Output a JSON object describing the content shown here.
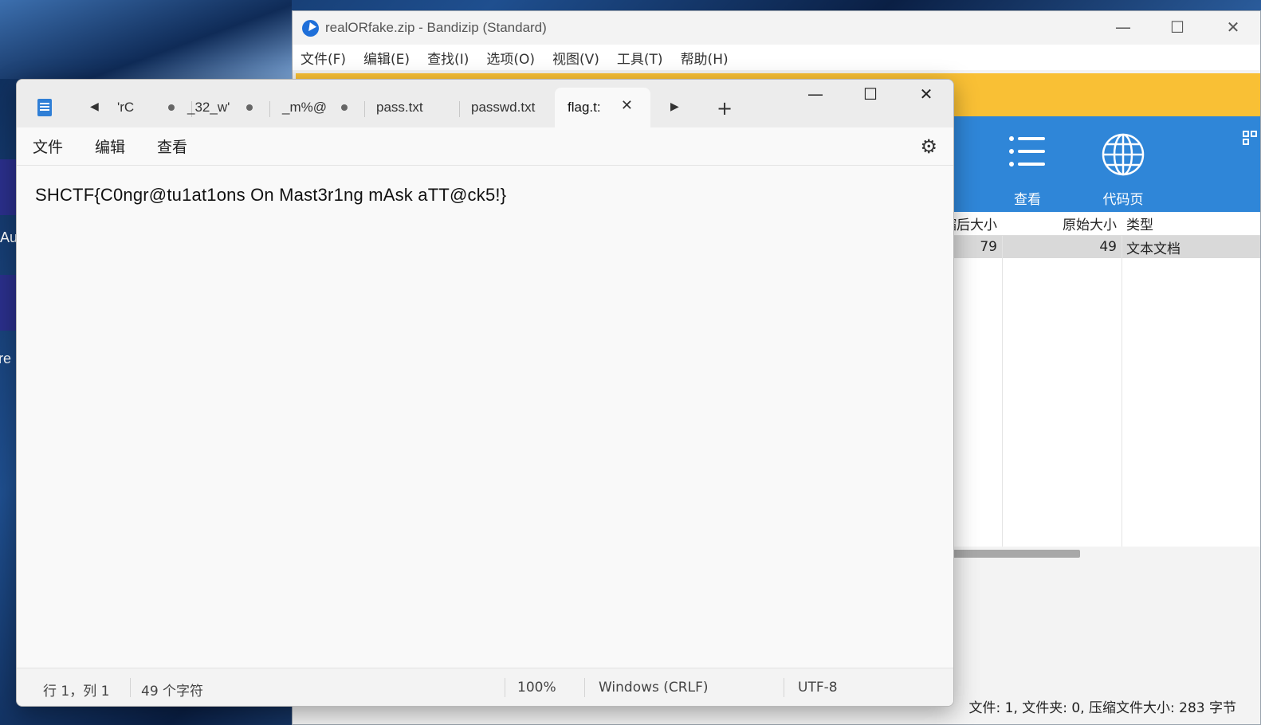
{
  "desktop": {
    "label_au": "Au",
    "label_pre": "Pre"
  },
  "bandizip": {
    "title": "realORfake.zip - Bandizip (Standard)",
    "controls": {
      "minimize": "—",
      "maximize": "☐",
      "close": "✕"
    },
    "menu": [
      "文件(F)",
      "编辑(E)",
      "查找(I)",
      "选项(O)",
      "视图(V)",
      "工具(T)",
      "帮助(H)"
    ],
    "toolbar": {
      "view_label": "查看",
      "codepage_label": "代码页"
    },
    "columns": {
      "compressed_size": "缩后大小",
      "original_size": "原始大小",
      "type": "类型"
    },
    "rows": [
      {
        "compressed_size": "79",
        "original_size": "49",
        "type": "文本文档"
      }
    ],
    "status": "文件: 1, 文件夹: 0, 压缩文件大小: 283 字节"
  },
  "notepad": {
    "tabs": [
      {
        "label": "'rC",
        "modified": true
      },
      {
        "label": "_32_w'",
        "modified": true
      },
      {
        "label": "_m%@",
        "modified": true
      },
      {
        "label": "pass.txt",
        "modified": false
      },
      {
        "label": "passwd.txt",
        "modified": false
      },
      {
        "label": "flag.t:",
        "modified": false,
        "active": true
      }
    ],
    "window_controls": {
      "minimize": "—",
      "maximize": "☐",
      "close": "✕"
    },
    "menu": {
      "file": "文件",
      "edit": "编辑",
      "view": "查看"
    },
    "content": "SHCTF{C0ngr@tu1at1ons On Mast3r1ng mAsk aTT@ck5!}",
    "status": {
      "position": "行 1，列 1",
      "chars": "49 个字符",
      "zoom": "100%",
      "line_ending": "Windows (CRLF)",
      "encoding": "UTF-8"
    }
  }
}
